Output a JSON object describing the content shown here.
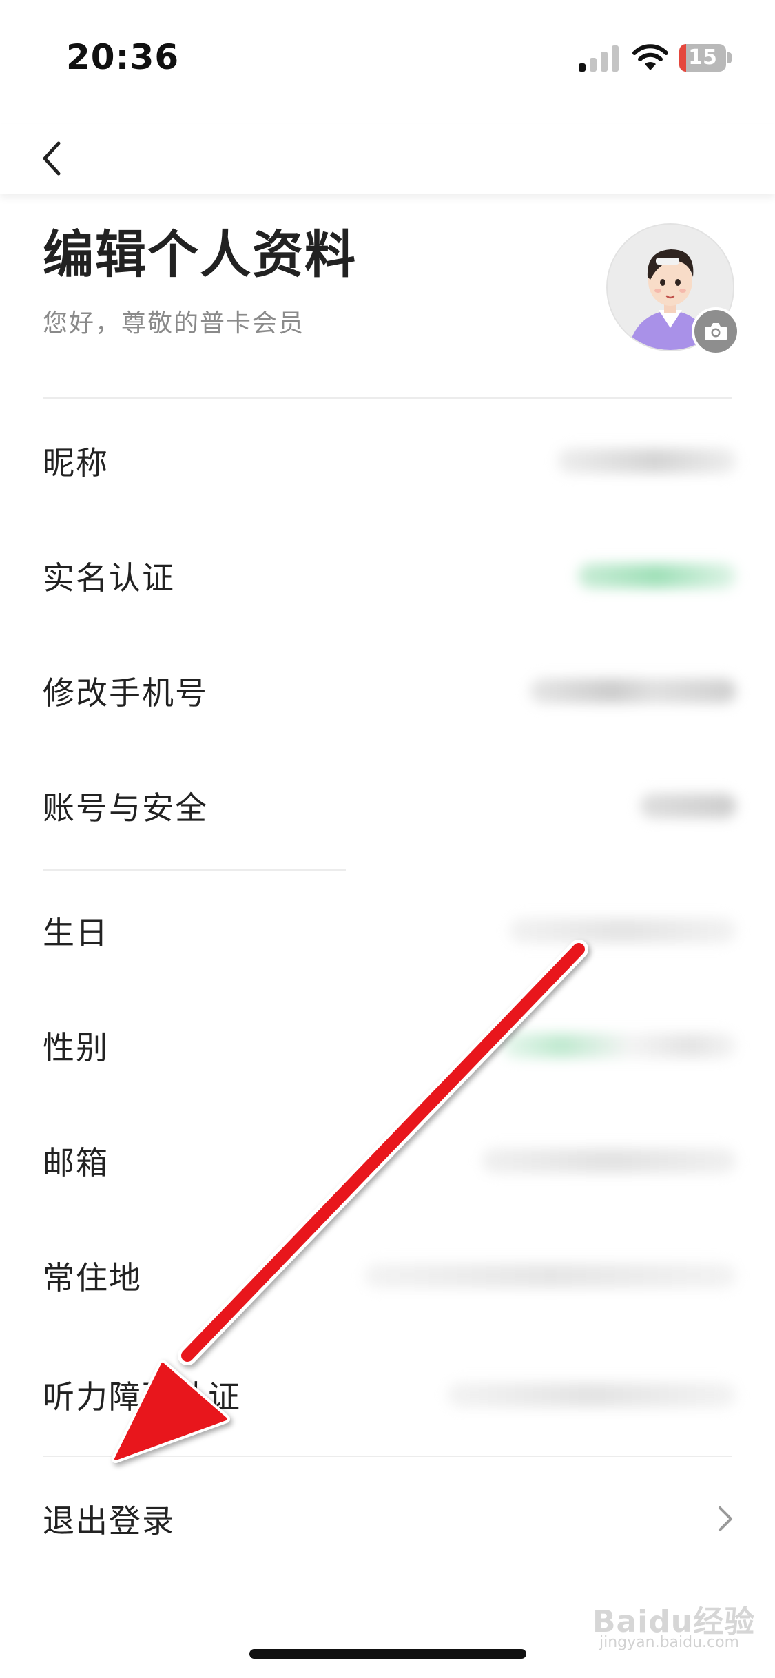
{
  "status_bar": {
    "time": "20:36",
    "battery_level": "15",
    "battery_percent": 15,
    "signal_icon": "cellular-signal-icon",
    "wifi_icon": "wifi-icon",
    "battery_icon": "battery-low-icon"
  },
  "nav": {
    "back_icon": "chevron-left-icon"
  },
  "header": {
    "title": "编辑个人资料",
    "subtitle": "您好，尊敬的普卡会员",
    "avatar_icon": "cartoon-avatar",
    "camera_icon": "camera-icon"
  },
  "rows": [
    {
      "label": "昵称"
    },
    {
      "label": "实名认证"
    },
    {
      "label": "修改手机号"
    },
    {
      "label": "账号与安全"
    },
    {
      "label": "生日"
    },
    {
      "label": "性别"
    },
    {
      "label": "邮箱"
    },
    {
      "label": "常住地"
    },
    {
      "label": "听力障碍认证"
    }
  ],
  "logout": {
    "label": "退出登录",
    "icon": "chevron-right-icon"
  },
  "watermark": {
    "text": "Baidu经验",
    "sub": "jingyan.baidu.com"
  },
  "colors": {
    "arrow": "#e8161b",
    "accent_green": "#2bb673",
    "text": "#222222",
    "subtext": "#8a8a8a"
  }
}
